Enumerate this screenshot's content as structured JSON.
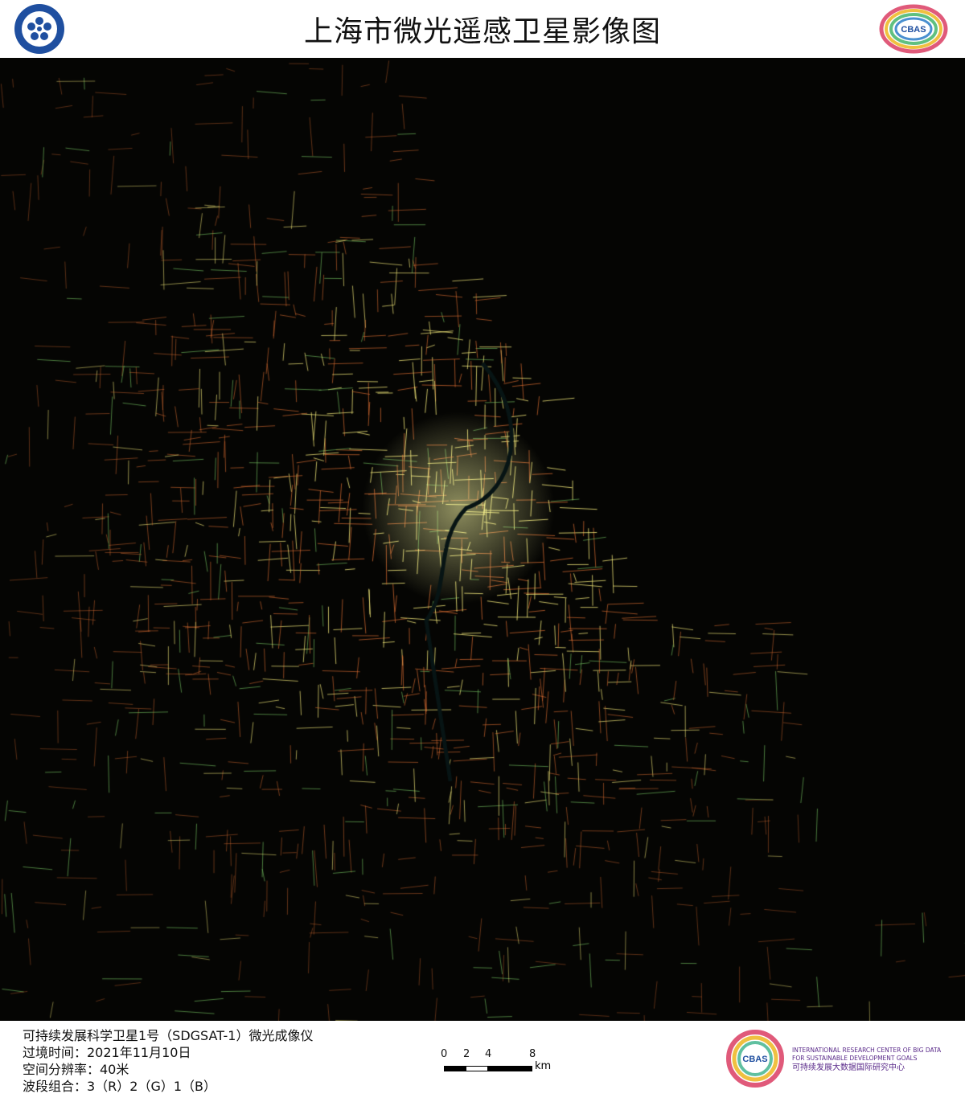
{
  "header": {
    "title": "上海市微光遥感卫星影像图",
    "left_logo": "Chinese Academy of Sciences",
    "right_logo": "CBAS"
  },
  "footer": {
    "info_lines": [
      "可持续发展科学卫星1号（SDGSAT-1）微光成像仪",
      "过境时间：2021年11月10日",
      "空间分辨率：40米",
      "波段组合：3（R）2（G）1（B）"
    ],
    "scale": {
      "ticks": [
        "0",
        "2",
        "4",
        "8"
      ],
      "unit": "km"
    },
    "org": {
      "logo": "CBAS",
      "line1": "INTERNATIONAL RESEARCH CENTER OF BIG DATA",
      "line2": "FOR SUSTAINABLE DEVELOPMENT GOALS",
      "line3": "可持续发展大数据国际研究中心"
    }
  },
  "colors": {
    "road": "#e0703a",
    "urban": "#f3f08a",
    "green": "#7fd06a",
    "background": "#050503"
  }
}
